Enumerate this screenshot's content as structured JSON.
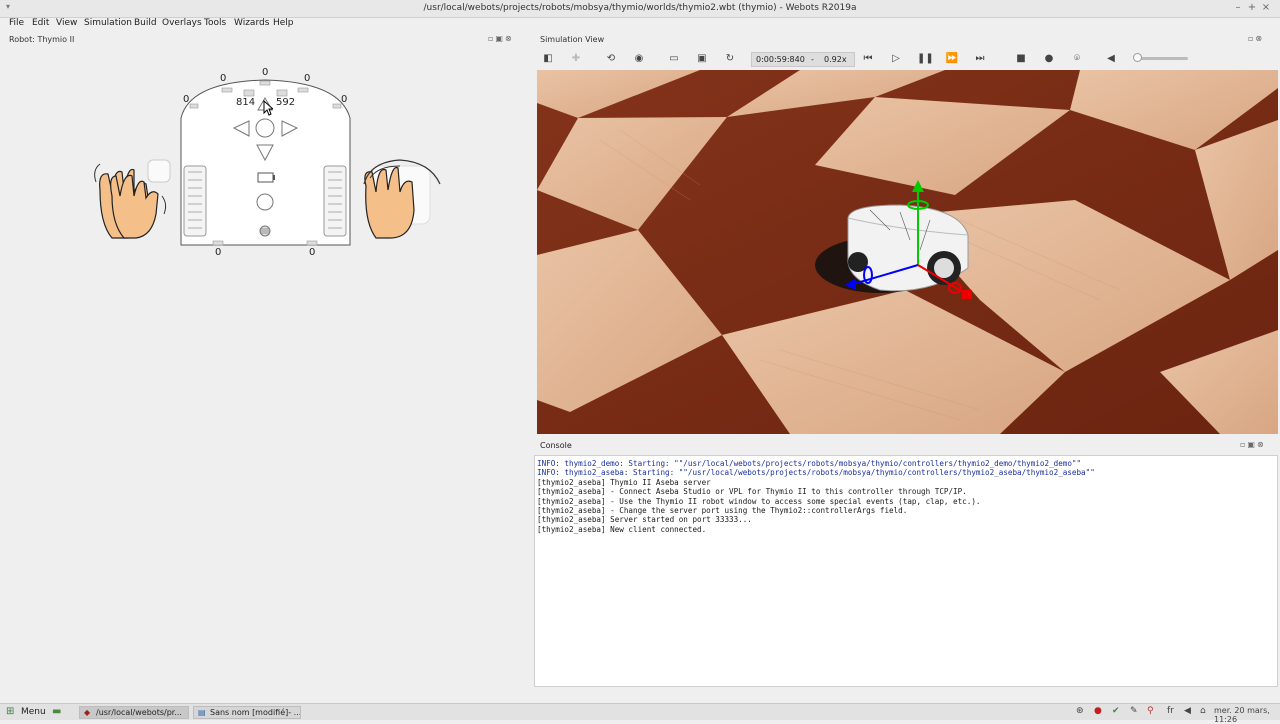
{
  "window": {
    "title": "/usr/local/webots/projects/robots/mobsya/thymio/worlds/thymio2.wbt (thymio) - Webots R2019a"
  },
  "menu": [
    "File",
    "Edit",
    "View",
    "Simulation",
    "Build",
    "Overlays",
    "Tools",
    "Wizards",
    "Help"
  ],
  "robot_panel": {
    "title": "Robot: Thymio II",
    "front_sensors": [
      "0",
      "0",
      "0",
      "0",
      "0"
    ],
    "ground_left_value": "814",
    "ground_right_value": "592",
    "rear_sensors": [
      "0",
      "0"
    ]
  },
  "simulation": {
    "title": "Simulation View",
    "time": "0:00:59:840",
    "separator": "-",
    "speed": "0.92x"
  },
  "console": {
    "title": "Console",
    "lines": [
      {
        "type": "info",
        "text": "INFO: thymio2_demo: Starting: \"\"/usr/local/webots/projects/robots/mobsya/thymio/controllers/thymio2_demo/thymio2_demo\"\""
      },
      {
        "type": "info",
        "text": "INFO: thymio2_aseba: Starting: \"\"/usr/local/webots/projects/robots/mobsya/thymio/controllers/thymio2_aseba/thymio2_aseba\"\""
      },
      {
        "type": "out",
        "text": "[thymio2_aseba] Thymio II Aseba server"
      },
      {
        "type": "out",
        "text": "[thymio2_aseba] - Connect Aseba Studio or VPL for Thymio II to this controller through TCP/IP."
      },
      {
        "type": "out",
        "text": "[thymio2_aseba] - Use the Thymio II robot window to access some special events (tap, clap, etc.)."
      },
      {
        "type": "out",
        "text": "[thymio2_aseba] - Change the server port using the Thymio2::controllerArgs field."
      },
      {
        "type": "out",
        "text": "[thymio2_aseba] Server started on port 33333..."
      },
      {
        "type": "out",
        "text": "[thymio2_aseba] New client connected."
      }
    ]
  },
  "taskbar": {
    "menu_label": "Menu",
    "tasks": [
      "/usr/local/webots/pr...",
      "Sans nom [modifié]- ..."
    ],
    "language": "fr",
    "clock": "mer. 20 mars, 11:26"
  },
  "colors": {
    "dark_wood": "#7a2a12",
    "light_wood": "#e2b99a",
    "info_text": "#1a2f9e"
  }
}
